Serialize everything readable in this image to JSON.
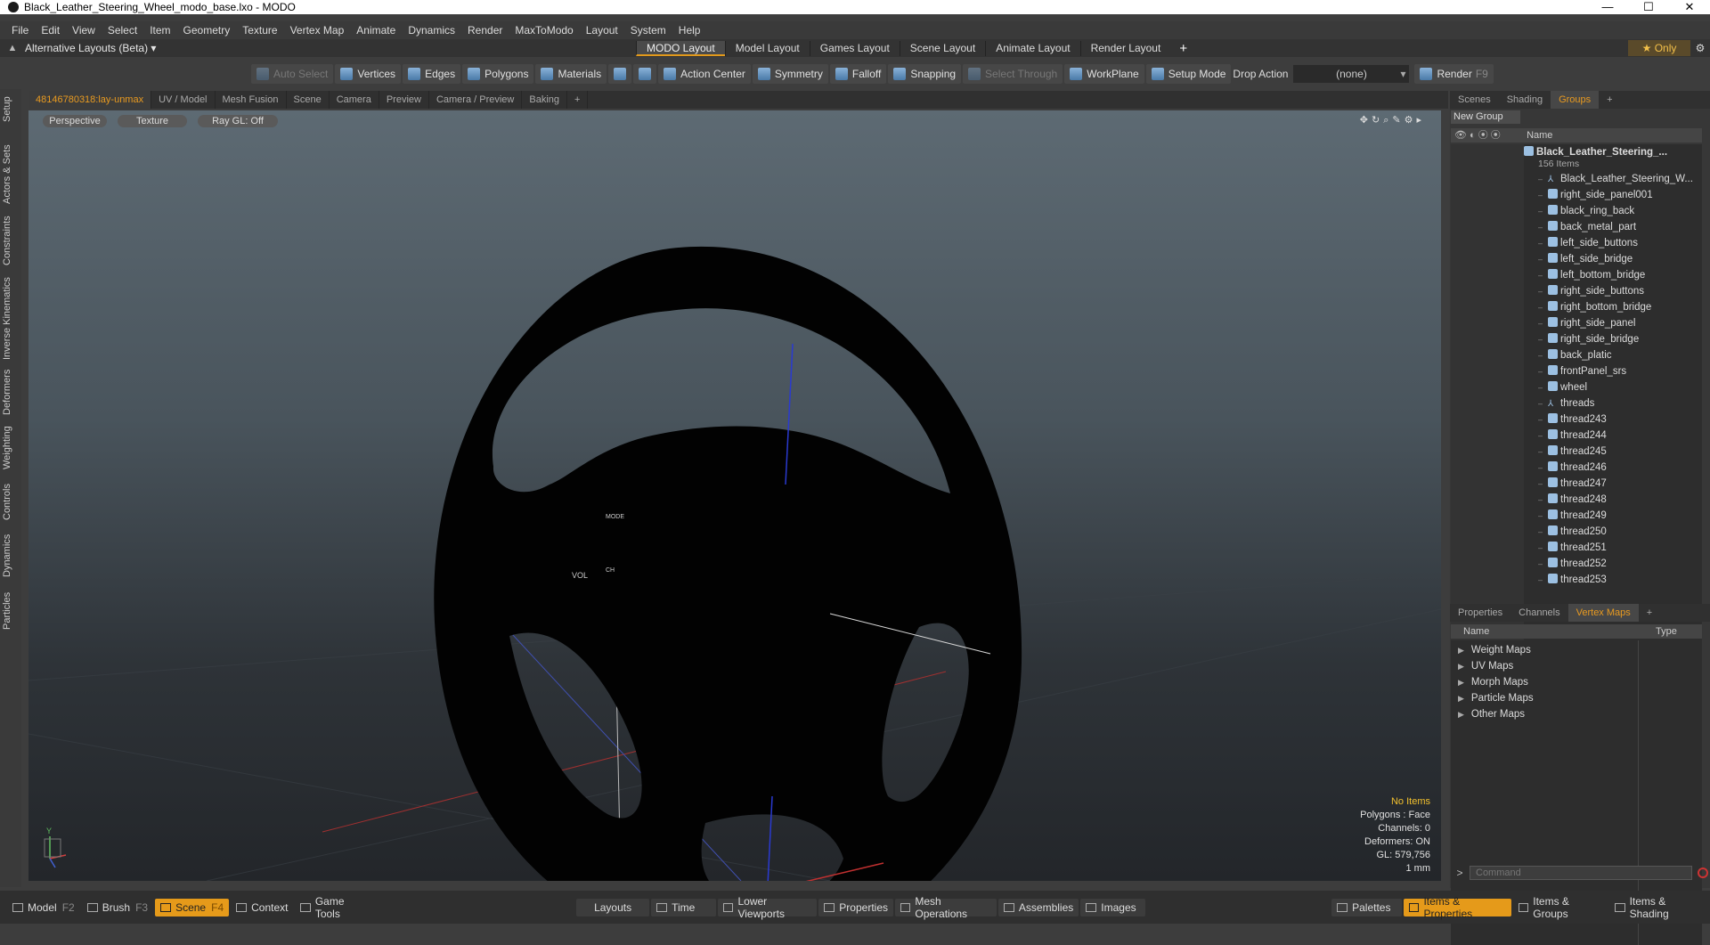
{
  "window": {
    "title": "Black_Leather_Steering_Wheel_modo_base.lxo - MODO",
    "min": "—",
    "max": "☐",
    "close": "✕"
  },
  "menu": [
    "File",
    "Edit",
    "View",
    "Select",
    "Item",
    "Geometry",
    "Texture",
    "Vertex Map",
    "Animate",
    "Dynamics",
    "Render",
    "MaxToModo",
    "Layout",
    "System",
    "Help"
  ],
  "layoutbar": {
    "alt_layouts": "Alternative Layouts (Beta) ▾",
    "tabs": [
      "MODO Layout",
      "Model Layout",
      "Games Layout",
      "Scene Layout",
      "Animate Layout",
      "Render Layout"
    ],
    "active_tab": "MODO Layout",
    "plus": "+",
    "only": "★ Only"
  },
  "toolbar": {
    "auto_select": "Auto Select",
    "vertices": "Vertices",
    "edges": "Edges",
    "polygons": "Polygons",
    "materials": "Materials",
    "action_center": "Action Center",
    "symmetry": "Symmetry",
    "falloff": "Falloff",
    "snapping": "Snapping",
    "select_through": "Select Through",
    "workplane": "WorkPlane",
    "setup_mode": "Setup Mode",
    "drop_action": "Drop Action",
    "drop_value": "(none)",
    "render": "Render",
    "render_key": "F9"
  },
  "left_tabs": [
    "Setup",
    "Actors & Sets",
    "Constraints",
    "Inverse Kinematics",
    "Deformers",
    "Weighting",
    "Controls",
    "Dynamics",
    "Particles"
  ],
  "viewport_tabs": [
    "48146780318:lay-unmax",
    "UV / Model",
    "Mesh Fusion",
    "Scene",
    "Camera",
    "Preview",
    "Camera / Preview",
    "Baking",
    "+"
  ],
  "viewport": {
    "view": "Perspective",
    "shading": "Texture",
    "raygl": "Ray GL: Off",
    "overlay_label1": "MODE",
    "overlay_label2": "VOL",
    "overlay_label3": "CH",
    "axis_y": "Y",
    "info": {
      "items": "No Items",
      "polygons": "Polygons : Face",
      "channels": "Channels: 0",
      "deformers": "Deformers: ON",
      "gl": "GL: 579,756",
      "unit": "1 mm"
    }
  },
  "right_panel": {
    "tabs": [
      "Scenes",
      "Shading",
      "Groups",
      "+"
    ],
    "active_tab": "Groups",
    "new_group": "New Group",
    "name_header": "Name",
    "group_name": "Black_Leather_Steering_...",
    "group_count": "156 Items",
    "items": [
      {
        "label": "Black_Leather_Steering_W...",
        "icon": "locator"
      },
      {
        "label": "right_side_panel001",
        "icon": "mesh"
      },
      {
        "label": "black_ring_back",
        "icon": "mesh"
      },
      {
        "label": "back_metal_part",
        "icon": "mesh"
      },
      {
        "label": "left_side_buttons",
        "icon": "mesh"
      },
      {
        "label": "left_side_bridge",
        "icon": "mesh"
      },
      {
        "label": "left_bottom_bridge",
        "icon": "mesh"
      },
      {
        "label": "right_side_buttons",
        "icon": "mesh"
      },
      {
        "label": "right_bottom_bridge",
        "icon": "mesh"
      },
      {
        "label": "right_side_panel",
        "icon": "mesh"
      },
      {
        "label": "right_side_bridge",
        "icon": "mesh"
      },
      {
        "label": "back_platic",
        "icon": "mesh"
      },
      {
        "label": "frontPanel_srs",
        "icon": "mesh"
      },
      {
        "label": "wheel",
        "icon": "mesh"
      },
      {
        "label": "threads",
        "icon": "locator"
      },
      {
        "label": "thread243",
        "icon": "mesh"
      },
      {
        "label": "thread244",
        "icon": "mesh"
      },
      {
        "label": "thread245",
        "icon": "mesh"
      },
      {
        "label": "thread246",
        "icon": "mesh"
      },
      {
        "label": "thread247",
        "icon": "mesh"
      },
      {
        "label": "thread248",
        "icon": "mesh"
      },
      {
        "label": "thread249",
        "icon": "mesh"
      },
      {
        "label": "thread250",
        "icon": "mesh"
      },
      {
        "label": "thread251",
        "icon": "mesh"
      },
      {
        "label": "thread252",
        "icon": "mesh"
      },
      {
        "label": "thread253",
        "icon": "mesh"
      }
    ],
    "props_tabs": [
      "Properties",
      "Channels",
      "Vertex Maps",
      "+"
    ],
    "props_active": "Vertex Maps",
    "vm_name": "Name",
    "vm_type": "Type",
    "vertex_maps": [
      "Weight Maps",
      "UV Maps",
      "Morph Maps",
      "Particle Maps",
      "Other Maps"
    ],
    "command_placeholder": "Command"
  },
  "bottombar": {
    "model": "Model",
    "model_key": "F2",
    "brush": "Brush",
    "brush_key": "F3",
    "scene": "Scene",
    "scene_key": "F4",
    "context": "Context",
    "game_tools": "Game Tools",
    "layouts": "Layouts",
    "time": "Time",
    "lower_viewports": "Lower Viewports",
    "properties": "Properties",
    "mesh_operations": "Mesh Operations",
    "assemblies": "Assemblies",
    "images": "Images",
    "palettes": "Palettes",
    "items_properties": "Items & Properties",
    "items_groups": "Items & Groups",
    "items_shading": "Items & Shading"
  }
}
